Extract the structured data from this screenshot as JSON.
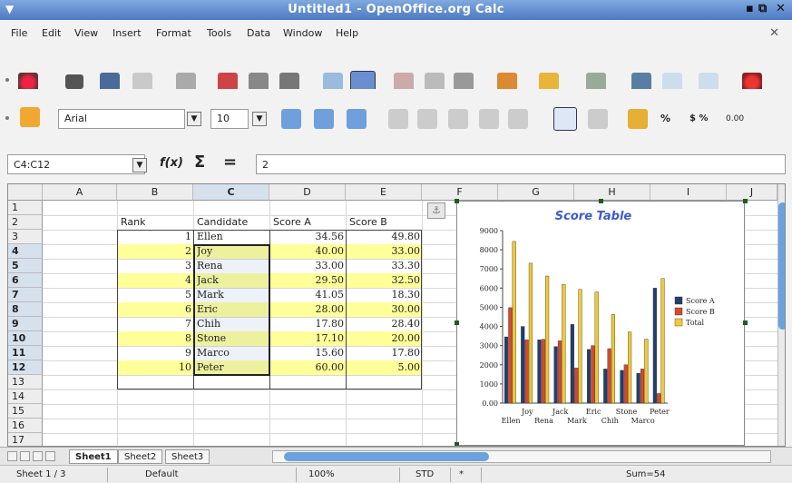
{
  "window": {
    "title": "Untitled1 - OpenOffice.org Calc",
    "menu_icon": "▼",
    "minimize": "▪",
    "maximize": "⧉",
    "close": "✕",
    "close_document": "✕"
  },
  "menu": [
    "File",
    "Edit",
    "View",
    "Insert",
    "Format",
    "Tools",
    "Data",
    "Window",
    "Help"
  ],
  "format_toolbar": {
    "font_name": "Arial",
    "font_size": "10",
    "percent": "%",
    "currency": "$ %",
    "decimal": "0.00"
  },
  "formula_bar": {
    "name_box": "C4:C12",
    "fx": "f(x)",
    "sum": "Σ",
    "equals": "=",
    "content": "2"
  },
  "columns": [
    "A",
    "B",
    "C",
    "D",
    "E",
    "F",
    "G",
    "H",
    "I",
    "J"
  ],
  "rows": [
    "1",
    "2",
    "3",
    "4",
    "5",
    "6",
    "7",
    "8",
    "9",
    "10",
    "11",
    "12",
    "13",
    "14",
    "15",
    "16",
    "17"
  ],
  "headers": {
    "rank": "Rank",
    "candidate": "Candidate",
    "score_a": "Score A",
    "score_b": "Score B"
  },
  "table": [
    {
      "rank": "1",
      "name": "Ellen",
      "a": "34.56",
      "b": "49.80"
    },
    {
      "rank": "2",
      "name": "Joy",
      "a": "40.00",
      "b": "33.00"
    },
    {
      "rank": "3",
      "name": "Rena",
      "a": "33.00",
      "b": "33.30"
    },
    {
      "rank": "4",
      "name": "Jack",
      "a": "29.50",
      "b": "32.50"
    },
    {
      "rank": "5",
      "name": "Mark",
      "a": "41.05",
      "b": "18.30"
    },
    {
      "rank": "6",
      "name": "Eric",
      "a": "28.00",
      "b": "30.00"
    },
    {
      "rank": "7",
      "name": "Chih",
      "a": "17.80",
      "b": "28.40"
    },
    {
      "rank": "8",
      "name": "Stone",
      "a": "17.10",
      "b": "20.00"
    },
    {
      "rank": "9",
      "name": "Marco",
      "a": "15.60",
      "b": "17.80"
    },
    {
      "rank": "10",
      "name": "Peter",
      "a": "60.00",
      "b": "5.00"
    }
  ],
  "chart_data": {
    "type": "bar",
    "title": "Score Table",
    "categories": [
      "Ellen",
      "Joy",
      "Rena",
      "Jack",
      "Mark",
      "Eric",
      "Chih",
      "Stone",
      "Marco",
      "Peter"
    ],
    "series": [
      {
        "name": "Score A",
        "values": [
          34.56,
          40.0,
          33.0,
          29.5,
          41.05,
          28.0,
          17.8,
          17.1,
          15.6,
          60.0
        ],
        "color": "#1f3f6e"
      },
      {
        "name": "Score B",
        "values": [
          49.8,
          33.0,
          33.3,
          32.5,
          18.3,
          30.0,
          28.4,
          20.0,
          17.8,
          5.0
        ],
        "color": "#d9482b"
      },
      {
        "name": "Total",
        "values": [
          84.36,
          73.0,
          66.3,
          62.0,
          59.35,
          58.0,
          46.2,
          37.1,
          33.4,
          65.0
        ],
        "color": "#f2c933"
      }
    ],
    "yticks": [
      "0.00",
      "1000",
      "2000",
      "3000",
      "4000",
      "5000",
      "6000",
      "7000",
      "8000",
      "9000"
    ],
    "ylim": [
      0,
      90
    ],
    "legend": "right",
    "grid": false
  },
  "sheets": [
    "Sheet1",
    "Sheet2",
    "Sheet3"
  ],
  "status": {
    "sheet": "Sheet 1 / 3",
    "style": "Default",
    "zoom": "100%",
    "mode": "STD",
    "modified": "*",
    "sum": "Sum=54"
  }
}
